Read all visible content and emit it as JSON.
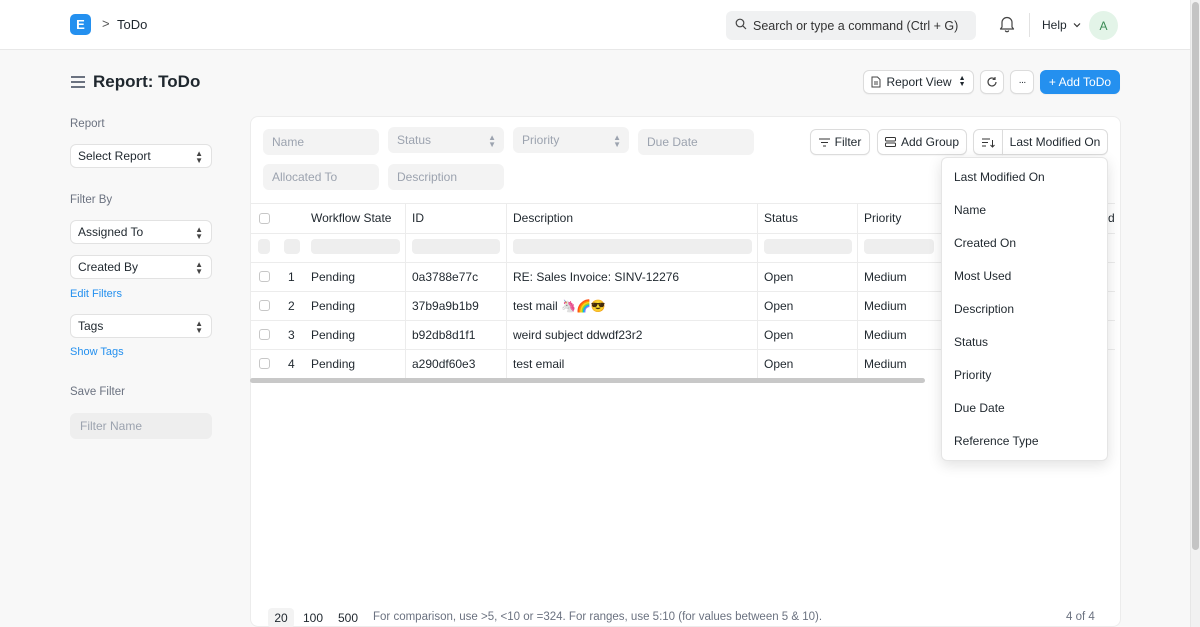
{
  "navbar": {
    "logo_letter": "E",
    "breadcrumb_sep": ">",
    "breadcrumb": "ToDo",
    "search_placeholder": "Search or type a command (Ctrl + G)",
    "help_label": "Help",
    "avatar_letter": "A"
  },
  "page": {
    "title": "Report: ToDo",
    "report_view_label": "Report View",
    "more_label": "···",
    "add_label": "+ Add ToDo"
  },
  "sidebar": {
    "report_label": "Report",
    "select_report": "Select Report",
    "filter_by_label": "Filter By",
    "assigned_to": "Assigned To",
    "created_by": "Created By",
    "edit_filters": "Edit Filters",
    "tags": "Tags",
    "show_tags": "Show Tags",
    "save_filter_label": "Save Filter",
    "filter_name_placeholder": "Filter Name"
  },
  "filters": {
    "name": "Name",
    "status": "Status",
    "priority": "Priority",
    "due_date": "Due Date",
    "allocated_to": "Allocated To",
    "description": "Description",
    "filter_btn": "Filter",
    "add_group_btn": "Add Group",
    "sort_btn": "Last Modified On"
  },
  "table": {
    "columns": [
      "Workflow State",
      "ID",
      "Description",
      "Status",
      "Priority"
    ],
    "rows": [
      {
        "num": "1",
        "state": "Pending",
        "id": "0a3788e77c",
        "description": "RE: Sales Invoice: SINV-12276",
        "status": "Open",
        "priority": "Medium"
      },
      {
        "num": "2",
        "state": "Pending",
        "id": "37b9a9b1b9",
        "description": "test mail 🦄🌈😎",
        "status": "Open",
        "priority": "Medium"
      },
      {
        "num": "3",
        "state": "Pending",
        "id": "b92db8d1f1",
        "description": "weird subject ddwdf23r2",
        "status": "Open",
        "priority": "Medium"
      },
      {
        "num": "4",
        "state": "Pending",
        "id": "a290df60e3",
        "description": "test email",
        "status": "Open",
        "priority": "Medium"
      }
    ],
    "clipped_header_char": "d"
  },
  "sort_menu": {
    "items": [
      "Last Modified On",
      "Name",
      "Created On",
      "Most Used",
      "Description",
      "Status",
      "Priority",
      "Due Date",
      "Reference Type"
    ]
  },
  "footer": {
    "page_sizes": [
      "20",
      "100",
      "500"
    ],
    "hint": "For comparison, use >5, <10 or =324. For ranges, use 5:10 (for values between 5 & 10).",
    "count": "4 of 4"
  },
  "colors": {
    "accent": "#2490ef",
    "text": "#1f272e",
    "muted": "#6b7280"
  }
}
